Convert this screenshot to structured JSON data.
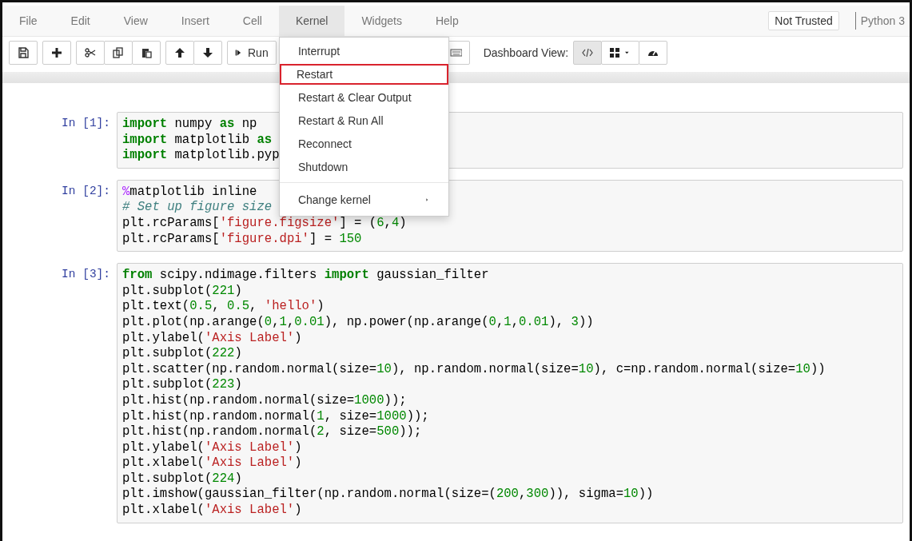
{
  "menubar": {
    "items": [
      {
        "label": "File",
        "selected": false
      },
      {
        "label": "Edit",
        "selected": false
      },
      {
        "label": "View",
        "selected": false
      },
      {
        "label": "Insert",
        "selected": false
      },
      {
        "label": "Cell",
        "selected": false
      },
      {
        "label": "Kernel",
        "selected": true
      },
      {
        "label": "Widgets",
        "selected": false
      },
      {
        "label": "Help",
        "selected": false
      }
    ],
    "trust_button": "Not Trusted",
    "kernel_name": "Python 3"
  },
  "toolbar": {
    "run_button": "Run",
    "dashboard_label": "Dashboard View:"
  },
  "kernel_menu": {
    "items": [
      {
        "kind": "item",
        "label": "Interrupt",
        "highlighted": false
      },
      {
        "kind": "item",
        "label": "Restart",
        "highlighted": true
      },
      {
        "kind": "item",
        "label": "Restart & Clear Output",
        "highlighted": false
      },
      {
        "kind": "item",
        "label": "Restart & Run All",
        "highlighted": false
      },
      {
        "kind": "item",
        "label": "Reconnect",
        "highlighted": false
      },
      {
        "kind": "item",
        "label": "Shutdown",
        "highlighted": false
      },
      {
        "kind": "divider"
      },
      {
        "kind": "submenu",
        "label": "Change kernel",
        "highlighted": false
      }
    ]
  },
  "cells": [
    {
      "prompt": "In [1]:",
      "lines": [
        [
          {
            "kind": "keyword",
            "text": "import"
          },
          {
            "kind": "plain",
            "text": " numpy "
          },
          {
            "kind": "keyword",
            "text": "as"
          },
          {
            "kind": "plain",
            "text": " np"
          }
        ],
        [
          {
            "kind": "keyword",
            "text": "import"
          },
          {
            "kind": "plain",
            "text": " matplotlib "
          },
          {
            "kind": "keyword",
            "text": "as"
          }
        ],
        [
          {
            "kind": "keyword",
            "text": "import"
          },
          {
            "kind": "plain",
            "text": " matplotlib.pyp"
          }
        ]
      ]
    },
    {
      "prompt": "In [2]:",
      "lines": [
        [
          {
            "kind": "magic",
            "text": "%"
          },
          {
            "kind": "plain",
            "text": "matplotlib inline"
          }
        ],
        [
          {
            "kind": "comment",
            "text": "# Set up figure size"
          }
        ],
        [
          {
            "kind": "plain",
            "text": "plt.rcParams["
          },
          {
            "kind": "string",
            "text": "'figure.figsize'"
          },
          {
            "kind": "plain",
            "text": "] = ("
          },
          {
            "kind": "number",
            "text": "6"
          },
          {
            "kind": "plain",
            "text": ","
          },
          {
            "kind": "number",
            "text": "4"
          },
          {
            "kind": "plain",
            "text": ")"
          }
        ],
        [
          {
            "kind": "plain",
            "text": "plt.rcParams["
          },
          {
            "kind": "string",
            "text": "'figure.dpi'"
          },
          {
            "kind": "plain",
            "text": "] = "
          },
          {
            "kind": "number",
            "text": "150"
          }
        ]
      ]
    },
    {
      "prompt": "In [3]:",
      "lines": [
        [
          {
            "kind": "keyword",
            "text": "from"
          },
          {
            "kind": "plain",
            "text": " scipy.ndimage.filters "
          },
          {
            "kind": "keyword",
            "text": "import"
          },
          {
            "kind": "plain",
            "text": " gaussian_filter"
          }
        ],
        [
          {
            "kind": "plain",
            "text": "plt.subplot("
          },
          {
            "kind": "number",
            "text": "221"
          },
          {
            "kind": "plain",
            "text": ")"
          }
        ],
        [
          {
            "kind": "plain",
            "text": "plt.text("
          },
          {
            "kind": "number",
            "text": "0.5"
          },
          {
            "kind": "plain",
            "text": ", "
          },
          {
            "kind": "number",
            "text": "0.5"
          },
          {
            "kind": "plain",
            "text": ", "
          },
          {
            "kind": "string",
            "text": "'hello'"
          },
          {
            "kind": "plain",
            "text": ")"
          }
        ],
        [
          {
            "kind": "plain",
            "text": "plt.plot(np.arange("
          },
          {
            "kind": "number",
            "text": "0"
          },
          {
            "kind": "plain",
            "text": ","
          },
          {
            "kind": "number",
            "text": "1"
          },
          {
            "kind": "plain",
            "text": ","
          },
          {
            "kind": "number",
            "text": "0.01"
          },
          {
            "kind": "plain",
            "text": "), np.power(np.arange("
          },
          {
            "kind": "number",
            "text": "0"
          },
          {
            "kind": "plain",
            "text": ","
          },
          {
            "kind": "number",
            "text": "1"
          },
          {
            "kind": "plain",
            "text": ","
          },
          {
            "kind": "number",
            "text": "0.01"
          },
          {
            "kind": "plain",
            "text": "), "
          },
          {
            "kind": "number",
            "text": "3"
          },
          {
            "kind": "plain",
            "text": "))"
          }
        ],
        [
          {
            "kind": "plain",
            "text": "plt.ylabel("
          },
          {
            "kind": "string",
            "text": "'Axis Label'"
          },
          {
            "kind": "plain",
            "text": ")"
          }
        ],
        [
          {
            "kind": "plain",
            "text": "plt.subplot("
          },
          {
            "kind": "number",
            "text": "222"
          },
          {
            "kind": "plain",
            "text": ")"
          }
        ],
        [
          {
            "kind": "plain",
            "text": "plt.scatter(np.random.normal(size="
          },
          {
            "kind": "number",
            "text": "10"
          },
          {
            "kind": "plain",
            "text": "), np.random.normal(size="
          },
          {
            "kind": "number",
            "text": "10"
          },
          {
            "kind": "plain",
            "text": "), c=np.random.normal(size="
          },
          {
            "kind": "number",
            "text": "10"
          },
          {
            "kind": "plain",
            "text": "))"
          }
        ],
        [
          {
            "kind": "plain",
            "text": "plt.subplot("
          },
          {
            "kind": "number",
            "text": "223"
          },
          {
            "kind": "plain",
            "text": ")"
          }
        ],
        [
          {
            "kind": "plain",
            "text": "plt.hist(np.random.normal(size="
          },
          {
            "kind": "number",
            "text": "1000"
          },
          {
            "kind": "plain",
            "text": "));"
          }
        ],
        [
          {
            "kind": "plain",
            "text": "plt.hist(np.random.normal("
          },
          {
            "kind": "number",
            "text": "1"
          },
          {
            "kind": "plain",
            "text": ", size="
          },
          {
            "kind": "number",
            "text": "1000"
          },
          {
            "kind": "plain",
            "text": "));"
          }
        ],
        [
          {
            "kind": "plain",
            "text": "plt.hist(np.random.normal("
          },
          {
            "kind": "number",
            "text": "2"
          },
          {
            "kind": "plain",
            "text": ", size="
          },
          {
            "kind": "number",
            "text": "500"
          },
          {
            "kind": "plain",
            "text": "));"
          }
        ],
        [
          {
            "kind": "plain",
            "text": "plt.ylabel("
          },
          {
            "kind": "string",
            "text": "'Axis Label'"
          },
          {
            "kind": "plain",
            "text": ")"
          }
        ],
        [
          {
            "kind": "plain",
            "text": "plt.xlabel("
          },
          {
            "kind": "string",
            "text": "'Axis Label'"
          },
          {
            "kind": "plain",
            "text": ")"
          }
        ],
        [
          {
            "kind": "plain",
            "text": "plt.subplot("
          },
          {
            "kind": "number",
            "text": "224"
          },
          {
            "kind": "plain",
            "text": ")"
          }
        ],
        [
          {
            "kind": "plain",
            "text": "plt.imshow(gaussian_filter(np.random.normal(size=("
          },
          {
            "kind": "number",
            "text": "200"
          },
          {
            "kind": "plain",
            "text": ","
          },
          {
            "kind": "number",
            "text": "300"
          },
          {
            "kind": "plain",
            "text": ")), sigma="
          },
          {
            "kind": "number",
            "text": "10"
          },
          {
            "kind": "plain",
            "text": "))"
          }
        ],
        [
          {
            "kind": "plain",
            "text": "plt.xlabel("
          },
          {
            "kind": "string",
            "text": "'Axis Label'"
          },
          {
            "kind": "plain",
            "text": ")"
          }
        ]
      ]
    }
  ]
}
